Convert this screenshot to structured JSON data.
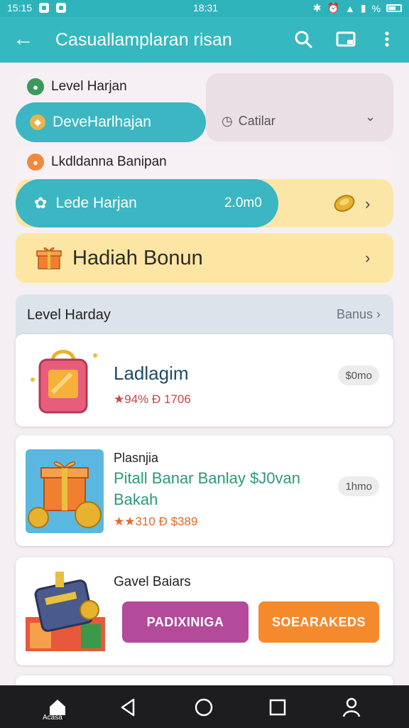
{
  "status_bar": {
    "left_text": "15:15",
    "time": "18:31",
    "percent": "%"
  },
  "app_bar": {
    "title": "Casuallamplaran risan"
  },
  "top_panel": {
    "label": "Level Harjan",
    "pill_label": "DeveHarlhajan",
    "select_value": "Catilar"
  },
  "mid_panel": {
    "label": "Lkdldanna Banipan",
    "pill_label": "Lede Harjan",
    "pill_value": "2.0m0"
  },
  "bonus": {
    "label": "Hadiah Bonun"
  },
  "section": {
    "title": "Level Harday",
    "more_label": "Banus"
  },
  "cards": [
    {
      "title": "Ladlagim",
      "rating": "★94% Ð 1706",
      "badge": "$0mo"
    },
    {
      "subtitle": "Plasnjia",
      "title_line1": "Pitall Banar Banlay  $J0van",
      "title_line2": "Bakah",
      "rating": "★★310 Ð $389",
      "badge": "1hmo"
    },
    {
      "title": "Gavel Baiars",
      "button_left": "PADIXINIGA",
      "button_right": "SOEARAKEDS"
    }
  ],
  "nav": {
    "home_label": "Acasa"
  },
  "colors": {
    "teal": "#35b8bf",
    "yellow": "#fde6a3",
    "purple": "#b34a9a",
    "orange": "#f58a2c",
    "navbar": "#1d1d1f"
  },
  "icons": [
    "back-arrow-icon",
    "search-icon",
    "cast-icon",
    "more-vert-icon",
    "gift-icon",
    "bag-icon",
    "coin-icon",
    "home-icon",
    "back-triangle-icon",
    "circle-home-icon",
    "square-recents-icon",
    "person-icon"
  ]
}
